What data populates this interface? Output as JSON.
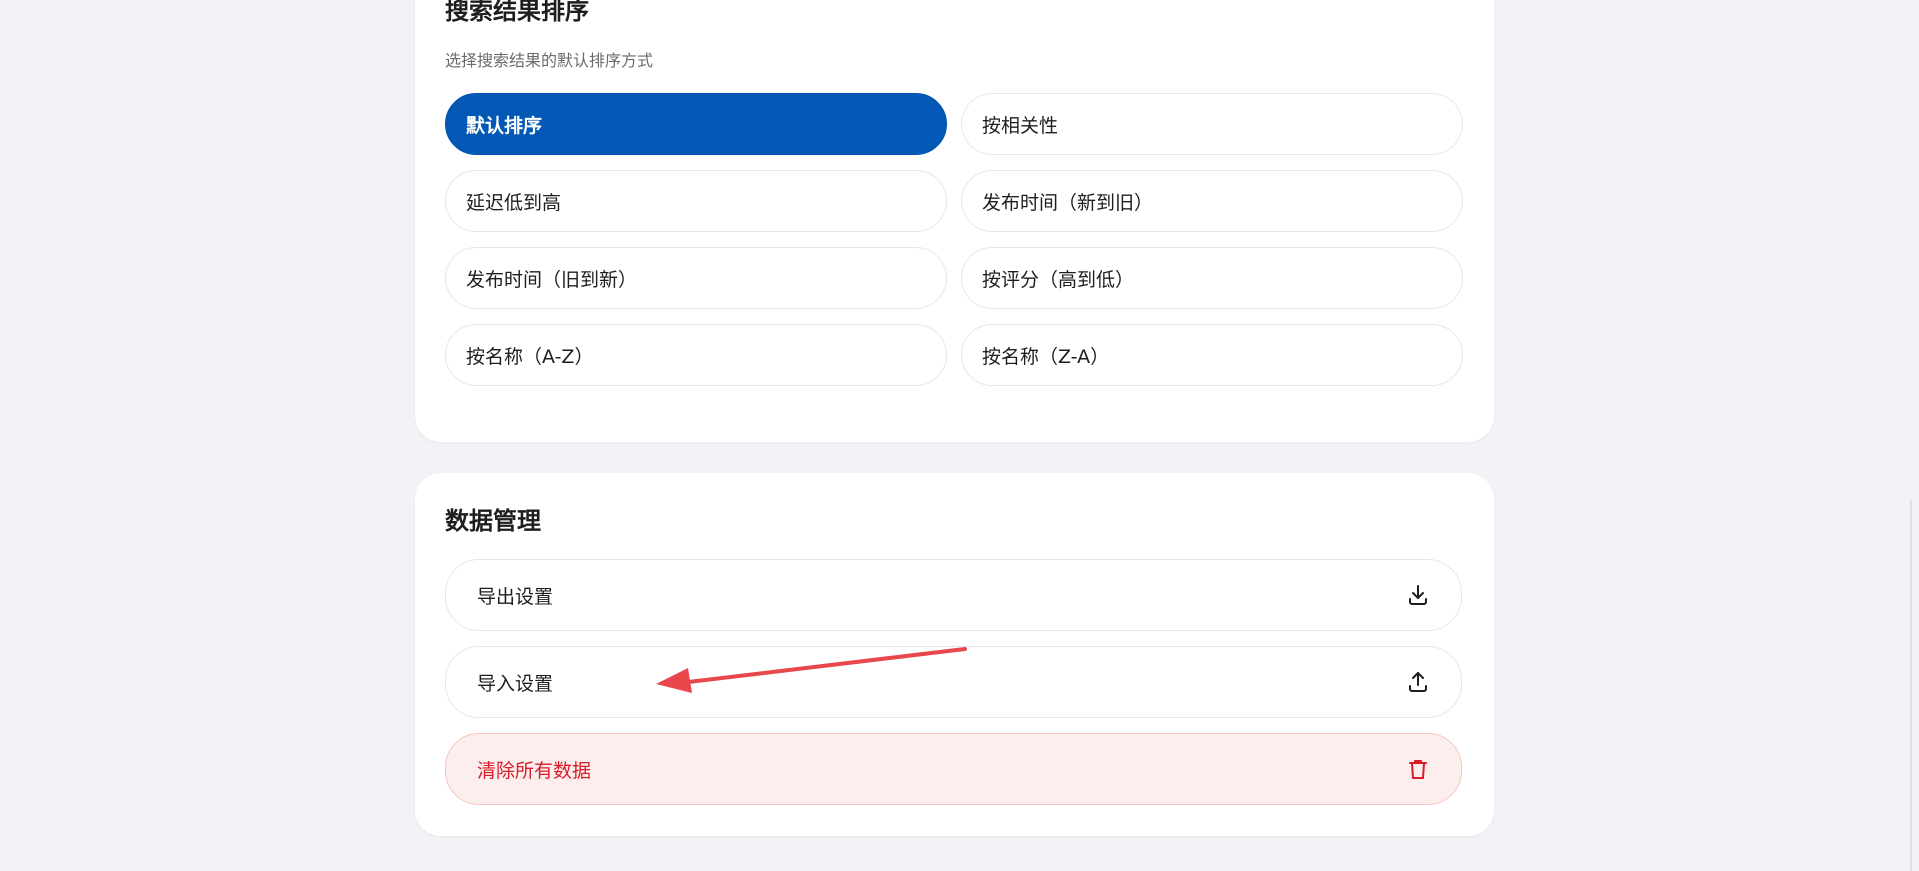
{
  "sort_section": {
    "title": "搜索结果排序",
    "description": "选择搜索结果的默认排序方式",
    "options": [
      {
        "label": "默认排序",
        "selected": true
      },
      {
        "label": "按相关性",
        "selected": false
      },
      {
        "label": "延迟低到高",
        "selected": false
      },
      {
        "label": "发布时间（新到旧）",
        "selected": false
      },
      {
        "label": "发布时间（旧到新）",
        "selected": false
      },
      {
        "label": "按评分（高到低）",
        "selected": false
      },
      {
        "label": "按名称（A-Z）",
        "selected": false
      },
      {
        "label": "按名称（Z-A）",
        "selected": false
      }
    ]
  },
  "data_section": {
    "title": "数据管理",
    "actions": [
      {
        "label": "导出设置",
        "icon": "download-icon"
      },
      {
        "label": "导入设置",
        "icon": "upload-icon"
      },
      {
        "label": "清除所有数据",
        "icon": "trash-icon"
      }
    ]
  },
  "colors": {
    "page_background": "#f2f3f6",
    "accent": "#0258b4",
    "danger_text": "#d81c2a",
    "danger_background": "#fdeeee",
    "annotation_arrow": "#e8474b"
  }
}
